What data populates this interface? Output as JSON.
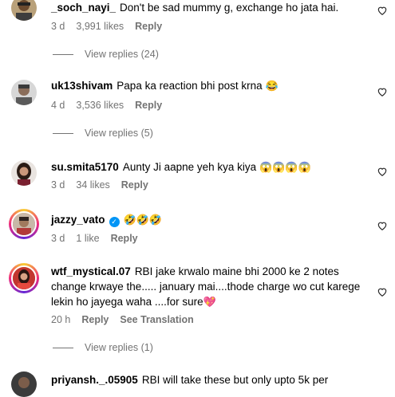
{
  "comments": [
    {
      "username": "_soch_nayi_",
      "text": "Don't be sad mummy g, exchange ho jata hai.",
      "time": "3 d",
      "likes": "3,991 likes",
      "reply": "Reply",
      "view_replies": "View replies (24)"
    },
    {
      "username": "uk13shivam",
      "text": "Papa ka reaction bhi post krna",
      "emoji": "😂",
      "time": "4 d",
      "likes": "3,536 likes",
      "reply": "Reply",
      "view_replies": "View replies (5)"
    },
    {
      "username": "su.smita5170",
      "text": "Aunty Ji aapne yeh kya kiya",
      "emoji": "😱😱😱😱",
      "time": "3 d",
      "likes": "34 likes",
      "reply": "Reply"
    },
    {
      "username": "jazzy_vato",
      "verified": "✓",
      "emoji": "🤣🤣🤣",
      "time": "3 d",
      "likes": "1 like",
      "reply": "Reply"
    },
    {
      "username": "wtf_mystical.07",
      "text": "RBI jake krwalo maine bhi 2000 ke 2 notes change krwaye the..... january mai....thode charge wo cut karege lekin ho jayega waha ....for sure",
      "emoji": "💖",
      "time": "20 h",
      "reply": "Reply",
      "see_translation": "See Translation",
      "view_replies": "View replies (1)"
    },
    {
      "username": "priyansh._.05905",
      "text": "RBI will take these but only upto 5k per"
    }
  ]
}
